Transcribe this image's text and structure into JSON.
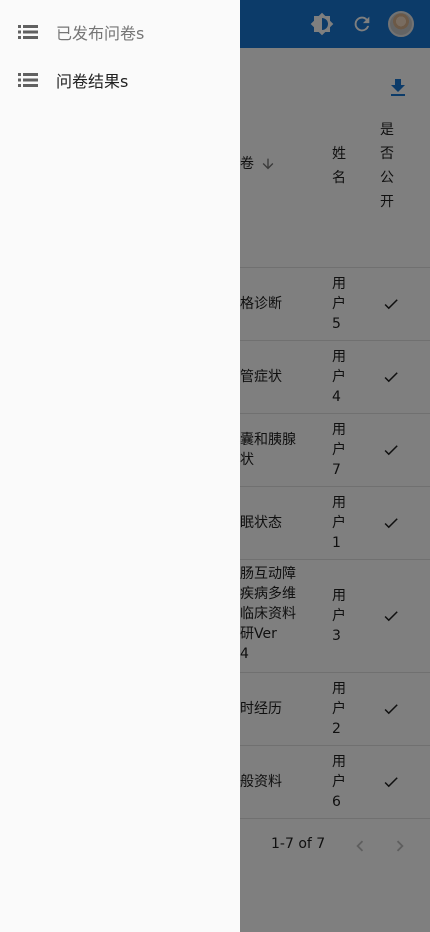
{
  "app": {
    "accent": "#1976d2",
    "icons": [
      "theme-icon",
      "refresh-icon",
      "avatar"
    ]
  },
  "drawer": {
    "items": [
      {
        "label": "已发布问卷s",
        "icon": "list-icon"
      },
      {
        "label": "问卷结果s",
        "icon": "list-icon"
      }
    ]
  },
  "table": {
    "headers": {
      "questionnaire": "卷",
      "name": "姓名",
      "public": "是否公开"
    },
    "rows": [
      {
        "questionnaire": "格诊断",
        "name": "用户5",
        "public": true
      },
      {
        "questionnaire": "管症状",
        "name": "用户4",
        "public": true
      },
      {
        "questionnaire": "囊和胰腺\n状",
        "name": "用户7",
        "public": true
      },
      {
        "questionnaire": "眠状态",
        "name": "用户1",
        "public": true
      },
      {
        "questionnaire": "肠互动障\n疾病多维\n临床资料\n研Ver\n4",
        "name": "用户3",
        "public": true
      },
      {
        "questionnaire": "时经历",
        "name": "用户2",
        "public": true
      },
      {
        "questionnaire": "般资料",
        "name": "用户6",
        "public": true
      }
    ]
  },
  "pagination": {
    "text": "1-7 of 7"
  }
}
